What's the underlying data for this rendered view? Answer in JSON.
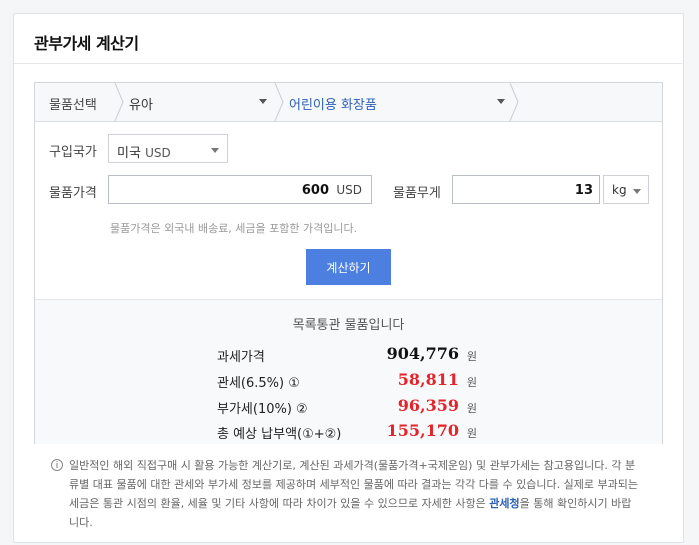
{
  "title": "관부가세 계산기",
  "category": {
    "label": "물품선택",
    "level1": "유아",
    "level2": "어린이용 화장품"
  },
  "country": {
    "label": "구입국가",
    "name": "미국",
    "currency": "USD"
  },
  "price": {
    "label": "물품가격",
    "value": "600",
    "unit": "USD",
    "hint": "물품가격은 외국내 배송료, 세금을 포함한 가격입니다."
  },
  "weight": {
    "label": "물품무게",
    "value": "13",
    "unit": "kg"
  },
  "calculate_label": "계산하기",
  "result": {
    "heading": "목록통관 물품입니다",
    "currency_suffix": "원",
    "rows": [
      {
        "label": "과세가격",
        "amount": "904,776"
      },
      {
        "label": "관세(6.5%) ①",
        "amount": "58,811"
      },
      {
        "label": "부가세(10%) ②",
        "amount": "96,359"
      },
      {
        "label": "총 예상 납부액(①+②)",
        "amount": "155,170"
      }
    ]
  },
  "notice": {
    "icon": "info-icon",
    "text": "일반적인 해외 직접구매 시 활용 가능한 계산기로, 계산된 과세가격(물품가격+국제운임) 및 관부가세는 참고용입니다. 각 분류별 대표 물품에 대한 관세와 부가세 정보를 제공하며 세부적인 물품에 따라 결과는 각각 다를 수 있습니다. 실제로 부과되는 세금은 통관 시점의 환율, 세율 및 기타 사항에 따라 차이가 있을 수 있으므로 자세한 사항은 ",
    "link": "관세청",
    "suffix": "을 통해 확인하시기 바랍니다."
  },
  "colors": {
    "accent": "#4d7fe0",
    "result_red": "#e3242b",
    "link_blue": "#2b5fb8"
  }
}
